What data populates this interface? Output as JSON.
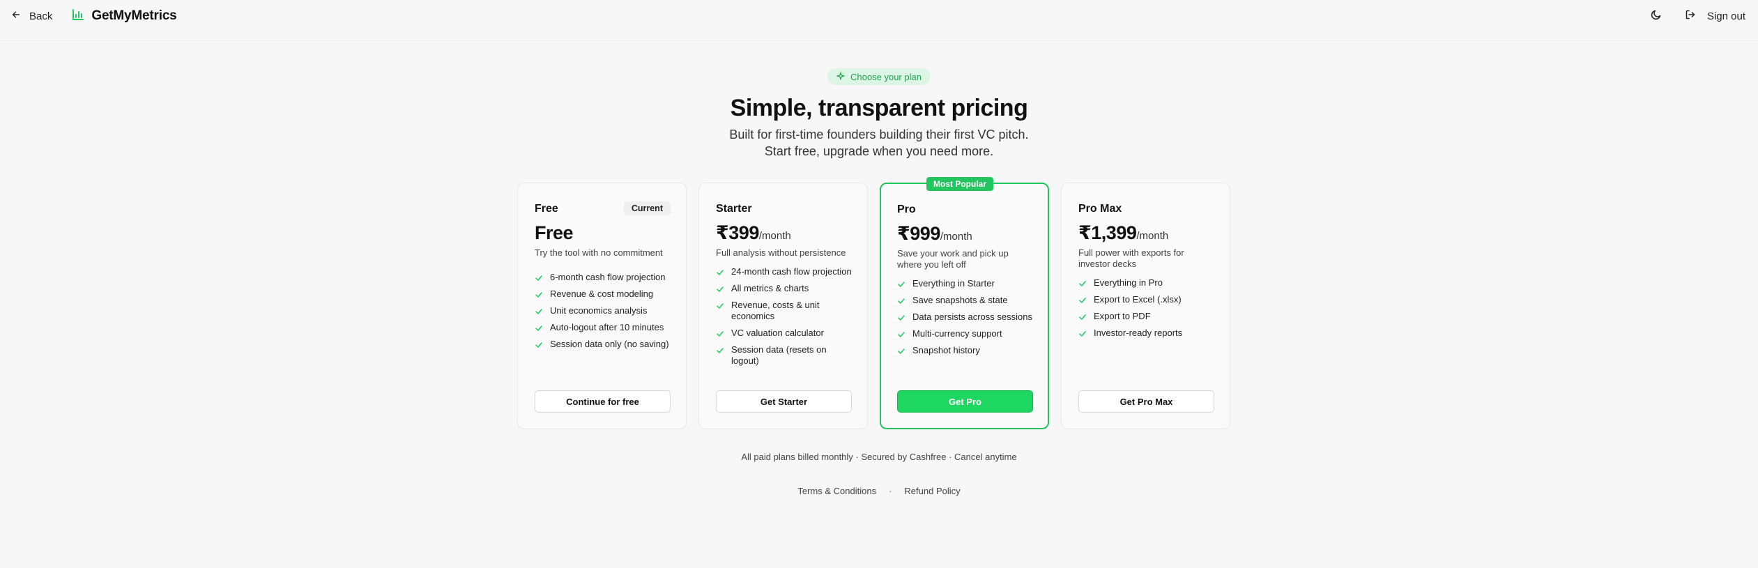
{
  "header": {
    "back_label": "Back",
    "brand_name": "GetMyMetrics",
    "signout_label": "Sign out"
  },
  "hero": {
    "chip_label": "Choose your plan",
    "title": "Simple, transparent pricing",
    "subtitle_line1": "Built for first-time founders building their first VC pitch.",
    "subtitle_line2": "Start free, upgrade when you need more."
  },
  "plans": [
    {
      "name": "Free",
      "badge": "Current",
      "price": "Free",
      "period": "",
      "description": "Try the tool with no commitment",
      "features": [
        "6-month cash flow projection",
        "Revenue & cost modeling",
        "Unit economics analysis",
        "Auto-logout after 10 minutes",
        "Session data only (no saving)"
      ],
      "cta": "Continue for free"
    },
    {
      "name": "Starter",
      "price": "₹399",
      "period": "/month",
      "description": "Full analysis without persistence",
      "features": [
        "24-month cash flow projection",
        "All metrics & charts",
        "Revenue, costs & unit economics",
        "VC valuation calculator",
        "Session data (resets on logout)"
      ],
      "cta": "Get Starter"
    },
    {
      "name": "Pro",
      "ribbon": "Most Popular",
      "price": "₹999",
      "period": "/month",
      "description": "Save your work and pick up where you left off",
      "features": [
        "Everything in Starter",
        "Save snapshots & state",
        "Data persists across sessions",
        "Multi-currency support",
        "Snapshot history"
      ],
      "cta": "Get Pro"
    },
    {
      "name": "Pro Max",
      "price": "₹1,399",
      "period": "/month",
      "description": "Full power with exports for investor decks",
      "features": [
        "Everything in Pro",
        "Export to Excel (.xlsx)",
        "Export to PDF",
        "Investor-ready reports"
      ],
      "cta": "Get Pro Max"
    }
  ],
  "footer": {
    "billing_note": "All paid plans billed monthly · Secured by Cashfree · Cancel anytime",
    "terms_label": "Terms & Conditions",
    "separator": "·",
    "refund_label": "Refund Policy"
  },
  "colors": {
    "accent": "#22c55e",
    "accent_button": "#1ed760",
    "chip_bg": "#dcf5e5",
    "chip_text": "#1fa352",
    "page_bg": "#f7f7f7",
    "card_bg": "#fafafa"
  },
  "icons": {
    "back": "arrow-left-icon",
    "brand": "bar-chart-icon",
    "theme": "moon-icon",
    "signout": "logout-icon",
    "chip": "sparkle-icon",
    "feature": "check-icon"
  }
}
